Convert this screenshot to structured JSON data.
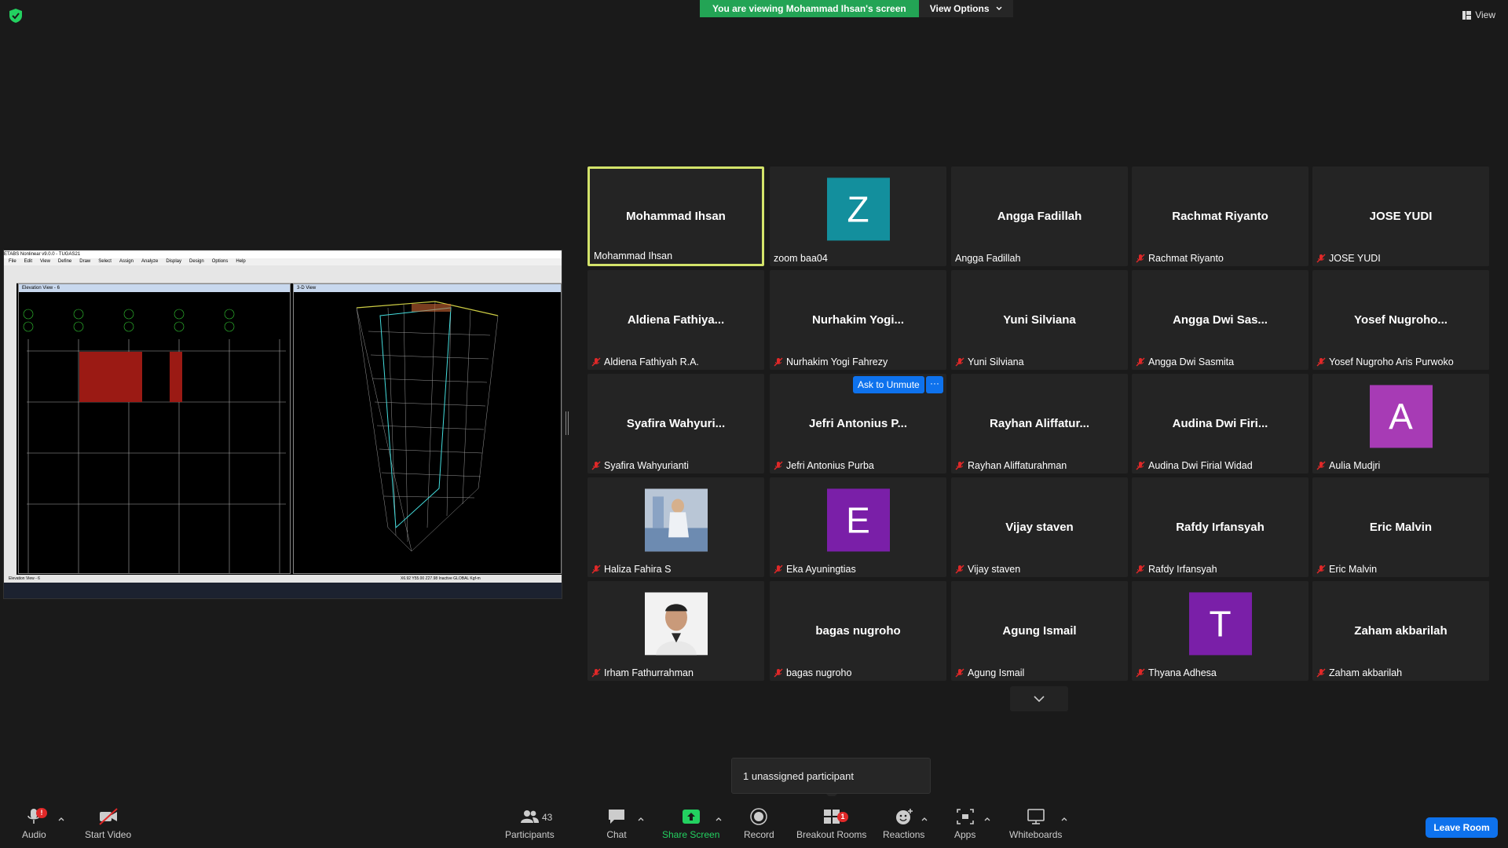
{
  "banner": {
    "viewing_text": "You are viewing Mohammad Ihsan's screen",
    "view_options": "View Options"
  },
  "top_view": "View",
  "shared_screen": {
    "window_title": "ETABS Nonlinear v9.0.0 - TUGAS21",
    "menu": [
      "File",
      "Edit",
      "View",
      "Define",
      "Draw",
      "Select",
      "Assign",
      "Analyze",
      "Display",
      "Design",
      "Options",
      "Help"
    ],
    "pane_left_title": "Elevation View - 6",
    "pane_right_title": "3-D View",
    "status_left": "Elevation View - 6",
    "status_right": "X6.92  Y55.00  Z27.98   Inactive   GLOBAL   Kgf-m"
  },
  "participants": [
    {
      "display": "Mohammad Ihsan",
      "label": "Mohammad Ihsan",
      "muted": false,
      "active": true
    },
    {
      "display": "",
      "label": "zoom baa04",
      "muted": false,
      "avatar": "Z",
      "avatar_color": "#138f9d"
    },
    {
      "display": "Angga Fadillah",
      "label": "Angga Fadillah",
      "muted": false
    },
    {
      "display": "Rachmat Riyanto",
      "label": "Rachmat Riyanto",
      "muted": true
    },
    {
      "display": "JOSE YUDI",
      "label": "JOSE YUDI",
      "muted": true
    },
    {
      "display": "Aldiena  Fathiya...",
      "label": "Aldiena Fathiyah R.A.",
      "muted": true
    },
    {
      "display": "Nurhakim  Yogi...",
      "label": "Nurhakim Yogi Fahrezy",
      "muted": true
    },
    {
      "display": "Yuni Silviana",
      "label": "Yuni Silviana",
      "muted": true
    },
    {
      "display": "Angga Dwi Sas...",
      "label": "Angga Dwi Sasmita",
      "muted": true
    },
    {
      "display": "Yosef  Nugroho...",
      "label": "Yosef Nugroho Aris Purwoko",
      "muted": true
    },
    {
      "display": "Syafira  Wahyuri...",
      "label": "Syafira Wahyurianti",
      "muted": true
    },
    {
      "display": "Jefri Antonius P...",
      "label": "Jefri Antonius Purba",
      "muted": true
    },
    {
      "display": "Rayhan  Aliffatur...",
      "label": "Rayhan Aliffaturahman",
      "muted": true
    },
    {
      "display": "Audina Dwi Firi...",
      "label": "Audina Dwi Firial Widad",
      "muted": true
    },
    {
      "display": "",
      "label": "Aulia Mudjri",
      "muted": true,
      "avatar": "A",
      "avatar_color": "#a73bb5"
    },
    {
      "display": "",
      "label": "Haliza Fahira S",
      "muted": true,
      "photo": "photo-person-sitting"
    },
    {
      "display": "",
      "label": "Eka Ayuningtias",
      "muted": true,
      "avatar": "E",
      "avatar_color": "#7a1fa8"
    },
    {
      "display": "Vijay staven",
      "label": "Vijay staven",
      "muted": true
    },
    {
      "display": "Rafdy Irfansyah",
      "label": "Rafdy Irfansyah",
      "muted": true
    },
    {
      "display": "Eric Malvin",
      "label": "Eric Malvin",
      "muted": true
    },
    {
      "display": "",
      "label": "Irham Fathurrahman",
      "muted": true,
      "photo": "photo-portrait"
    },
    {
      "display": "bagas nugroho",
      "label": "bagas nugroho",
      "muted": true
    },
    {
      "display": "Agung Ismail",
      "label": "Agung Ismail",
      "muted": true
    },
    {
      "display": "",
      "label": "Thyana Adhesa",
      "muted": true,
      "avatar": "T",
      "avatar_color": "#7a1fa8"
    },
    {
      "display": "Zaham akbarilah",
      "label": "Zaham akbarilah",
      "muted": true
    }
  ],
  "ask_unmute": "Ask to Unmute",
  "more": "···",
  "unassigned": "1 unassigned participant",
  "toolbar": {
    "audio": "Audio",
    "audio_badge": "!",
    "start_video": "Start Video",
    "participants": "Participants",
    "participants_count": "43",
    "chat": "Chat",
    "share_screen": "Share Screen",
    "record": "Record",
    "breakout_rooms": "Breakout Rooms",
    "breakout_badge": "1",
    "reactions": "Reactions",
    "apps": "Apps",
    "whiteboards": "Whiteboards",
    "leave_room": "Leave Room"
  }
}
